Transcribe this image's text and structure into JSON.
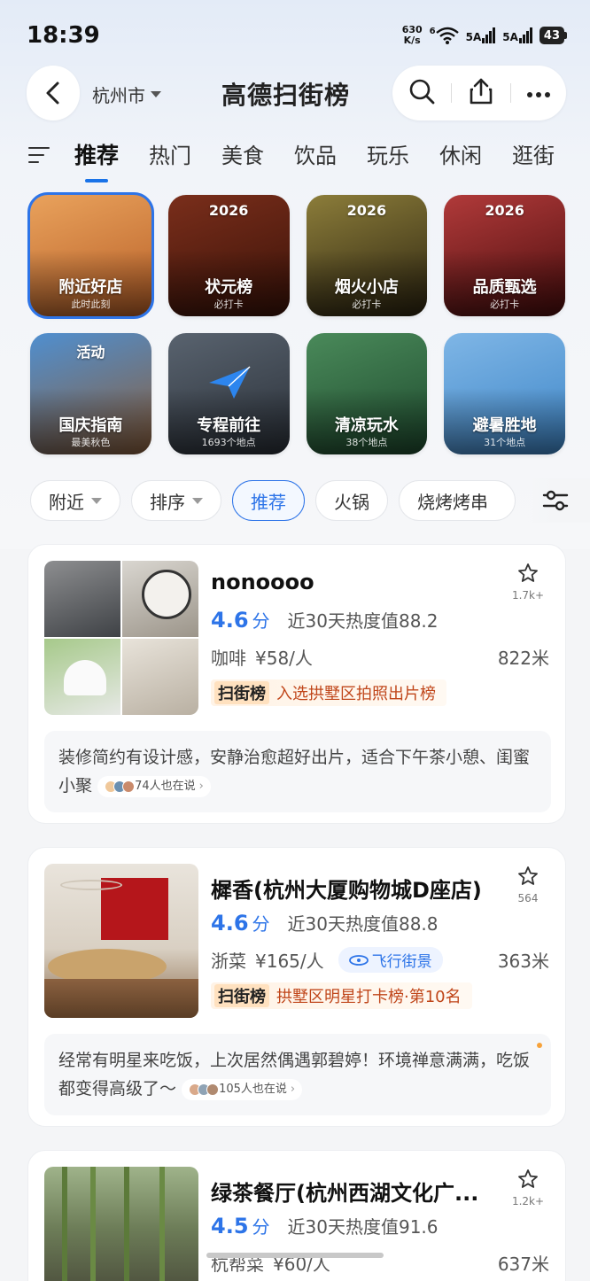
{
  "status": {
    "time": "18:39",
    "netspeed_value": "630",
    "netspeed_unit": "K/s",
    "signal1": "5A",
    "signal2": "5A",
    "battery": "43",
    "wifi_badge": "6"
  },
  "header": {
    "city": "杭州市",
    "logo": "高德扫街榜"
  },
  "tabs": [
    {
      "label": "推荐",
      "active": true
    },
    {
      "label": "热门"
    },
    {
      "label": "美食"
    },
    {
      "label": "饮品"
    },
    {
      "label": "玩乐"
    },
    {
      "label": "休闲"
    },
    {
      "label": "逛街"
    }
  ],
  "tiles": [
    {
      "label": "附近好店",
      "sub": "此时此刻",
      "badge": "",
      "colors": [
        "#e9a25c",
        "#b85f27"
      ],
      "selected": true
    },
    {
      "label": "状元榜",
      "sub": "必打卡",
      "badge": "2026",
      "colors": [
        "#7a2e1b",
        "#3a1208"
      ]
    },
    {
      "label": "烟火小店",
      "sub": "必打卡",
      "badge": "2026",
      "colors": [
        "#8c7d3a",
        "#2c2410"
      ]
    },
    {
      "label": "品质甄选",
      "sub": "必打卡",
      "badge": "2026",
      "colors": [
        "#b13a3a",
        "#4a0d0d"
      ]
    },
    {
      "label": "国庆指南",
      "sub": "最美秋色",
      "badge": "活动",
      "colors": [
        "#4f8fd0",
        "#8a5e3b"
      ]
    },
    {
      "label": "专程前往",
      "sub": "1693个地点",
      "badge": "",
      "colors": [
        "#59636f",
        "#2a3038"
      ]
    },
    {
      "label": "清凉玩水",
      "sub": "38个地点",
      "badge": "",
      "colors": [
        "#4a8a5a",
        "#1e4a2e"
      ]
    },
    {
      "label": "避暑胜地",
      "sub": "31个地点",
      "badge": "",
      "colors": [
        "#7fb6e6",
        "#3e86c8"
      ]
    }
  ],
  "filters": [
    {
      "label": "附近",
      "dropdown": true
    },
    {
      "label": "排序",
      "dropdown": true
    },
    {
      "label": "推荐",
      "active": true
    },
    {
      "label": "火锅"
    },
    {
      "label": "烧烤烤串"
    }
  ],
  "cards": [
    {
      "title": "nonoooo",
      "fav_count": "1.7k+",
      "rating": "4.6",
      "rating_unit": "分",
      "heat": "近30天热度值88.2",
      "category": "咖啡",
      "price": "¥58/人",
      "feijie": "",
      "distance": "822米",
      "rank_logo": "扫街榜",
      "rank_text": "入选拱墅区拍照出片榜",
      "review": "装修简约有设计感，安静治愈超好出片，适合下午茶小憩、闺蜜小聚",
      "talk": "74人也在说"
    },
    {
      "title": "樨香(杭州大厦购物城D座店)",
      "fav_count": "564",
      "rating": "4.6",
      "rating_unit": "分",
      "heat": "近30天热度值88.8",
      "category": "浙菜",
      "price": "¥165/人",
      "feijie": "飞行街景",
      "distance": "363米",
      "rank_logo": "扫街榜",
      "rank_text": "拱墅区明星打卡榜·第10名",
      "review": "经常有明星来吃饭，上次居然偶遇郭碧婷！环境禅意满满，吃饭都变得高级了～",
      "talk": "105人也在说"
    },
    {
      "title": "绿茶餐厅(杭州西湖文化广...",
      "fav_count": "1.2k+",
      "rating": "4.5",
      "rating_unit": "分",
      "heat": "近30天热度值91.6",
      "category": "杭帮菜",
      "price": "¥60/人",
      "distance": "637米"
    }
  ]
}
